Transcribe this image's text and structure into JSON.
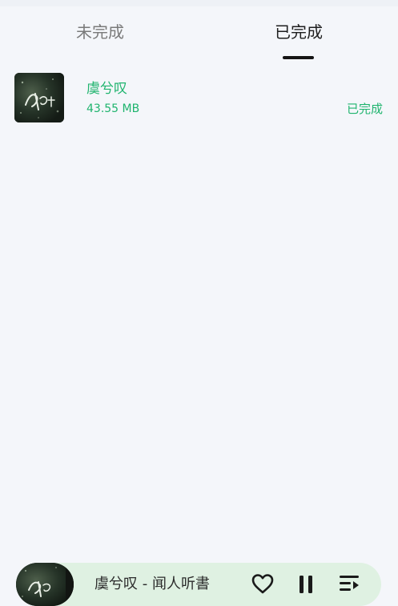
{
  "tabs": [
    {
      "label": "未完成",
      "active": false
    },
    {
      "label": "已完成",
      "active": true
    }
  ],
  "downloads": [
    {
      "title": "虞兮叹",
      "size": "43.55 MB",
      "status": "已完成",
      "cover_icon": "album-cover-image"
    }
  ],
  "mini_player": {
    "title": "虞兮叹 - 闻人听書",
    "favorite_icon": "heart-outline-icon",
    "play_icon": "pause-icon",
    "playlist_icon": "playlist-icon"
  },
  "colors": {
    "accent_green": "#1fb46e",
    "tab_active": "#1e1e1e",
    "tab_inactive": "#7a7a7a",
    "page_background": "#f4f6fa",
    "mini_player_background": "#dff1e2"
  }
}
